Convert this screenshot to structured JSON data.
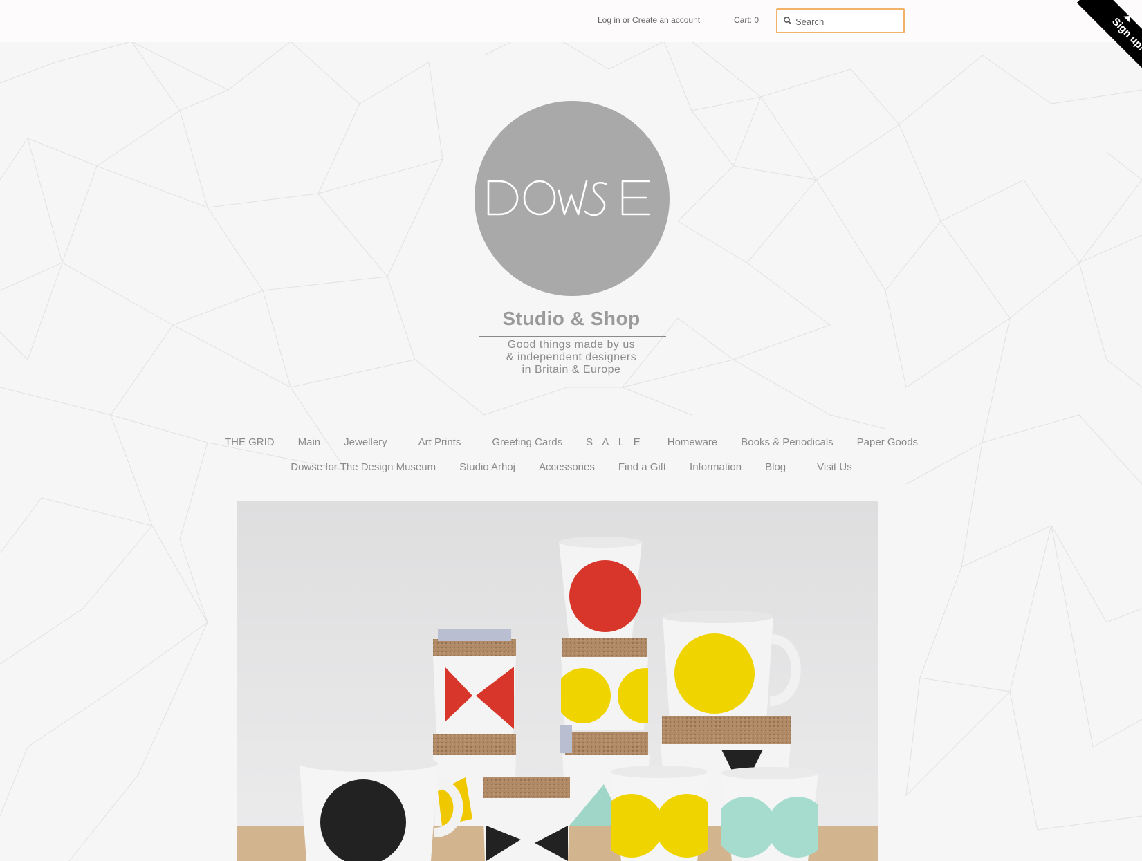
{
  "header": {
    "account_text": "Log in or Create an account",
    "cart_text": "Cart: 0",
    "search": {
      "placeholder": "Search",
      "value": ""
    },
    "signup_ribbon": "Sign up!"
  },
  "logo": {
    "wordmark": "DOWSE",
    "title": "Studio & Shop",
    "tagline": [
      "Good things made by us",
      "& independent designers",
      "in Britain & Europe"
    ]
  },
  "nav": {
    "row1": [
      "THE GRID",
      "Main",
      "Jewellery",
      "Art Prints",
      "Greeting Cards",
      "S A L E",
      "Homeware",
      "Books & Periodicals",
      "Paper Goods"
    ],
    "row2": [
      "Dowse for The Design Museum",
      "Studio Arhoj",
      "Accessories",
      "Find a Gift",
      "Information",
      "Blog",
      "Visit Us"
    ]
  },
  "hero": {
    "alt": "Stack of ceramic cups and mugs with geometric red, yellow, black and mint patterns"
  },
  "colors": {
    "accent_search_border": "#f3b26a",
    "logo_circle": "#a9a9a9",
    "text_gray": "#8a8a8a",
    "ribbon": "#000000"
  },
  "icons": [
    "search-icon",
    "ribbon-arrow-icon"
  ]
}
